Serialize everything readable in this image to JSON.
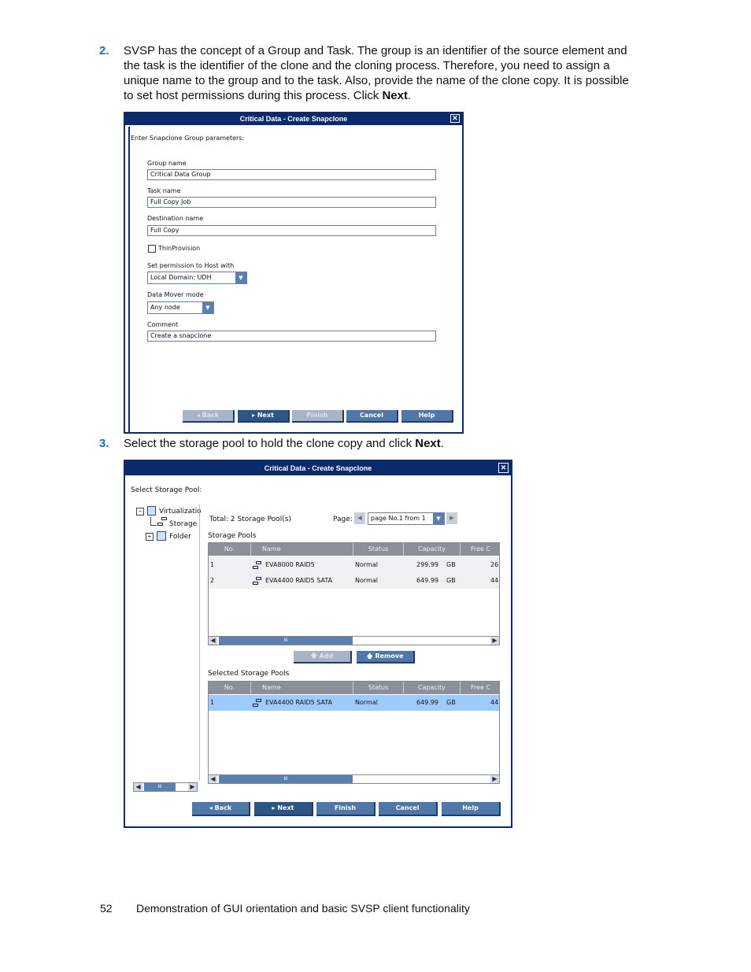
{
  "step2": {
    "num": "2.",
    "text": "SVSP has the concept of a Group and Task. The group is an identifier of the source element and the task is the identifier of the clone and the cloning process. Therefore, you need to assign a unique name to the group and to the task. Also, provide the name of the clone copy. It is possible to set host permissions during this process. Click ",
    "bold": "Next",
    "end": "."
  },
  "dialog1": {
    "title": "Critical Data - Create Snapclone",
    "intro": "Enter Snapclone Group parameters:",
    "group_label": "Group name",
    "group_value": "Critical Data Group",
    "task_label": "Task name",
    "task_value": "Full Copy Job",
    "dest_label": "Destination name",
    "dest_value": "Full Copy",
    "thin_label": "ThinProvision",
    "thin_checked": false,
    "perm_label": "Set permission to Host with",
    "perm_value": "Local Domain: UDH",
    "mover_label": "Data Mover mode",
    "mover_value": "Any node",
    "comment_label": "Comment",
    "comment_value": "Create a snapclone",
    "buttons": {
      "back": "Back",
      "next": "Next",
      "finish": "Finish",
      "cancel": "Cancel",
      "help": "Help"
    }
  },
  "step3": {
    "num": "3.",
    "text": "Select the storage pool to hold the clone copy and click ",
    "bold": "Next",
    "end": "."
  },
  "dialog2": {
    "title": "Critical Data - Create Snapclone",
    "intro": "Select Storage Pool:",
    "tree": [
      "Virtualizatio",
      "Storage",
      "Folder"
    ],
    "total": "Total: 2 Storage Pool(s)",
    "page_label": "Page:",
    "page_value": "page No.1 from 1",
    "pools_label": "Storage Pools",
    "columns": [
      "No.",
      "Name",
      "Status",
      "Capacity",
      "Free C"
    ],
    "pools": [
      {
        "no": "1",
        "name": "EVA8000 RAID5",
        "status": "Normal",
        "capacity": "299.99",
        "unit": "GB",
        "free": "26"
      },
      {
        "no": "2",
        "name": "EVA4400 RAID5 SATA",
        "status": "Normal",
        "capacity": "649.99",
        "unit": "GB",
        "free": "44"
      }
    ],
    "add": "Add",
    "remove": "Remove",
    "selected_label": "Selected Storage Pools",
    "selected": [
      {
        "no": "1",
        "name": "EVA4400 RAID5 SATA",
        "status": "Normal",
        "capacity": "649.99",
        "unit": "GB",
        "free": "44"
      }
    ],
    "scroll_mark": "III",
    "tree_scroll_mark": "III",
    "buttons": {
      "back": "Back",
      "next": "Next",
      "finish": "Finish",
      "cancel": "Cancel",
      "help": "Help"
    }
  },
  "footer": {
    "page_number": "52",
    "title": "Demonstration of GUI orientation and basic SVSP client functionality"
  }
}
